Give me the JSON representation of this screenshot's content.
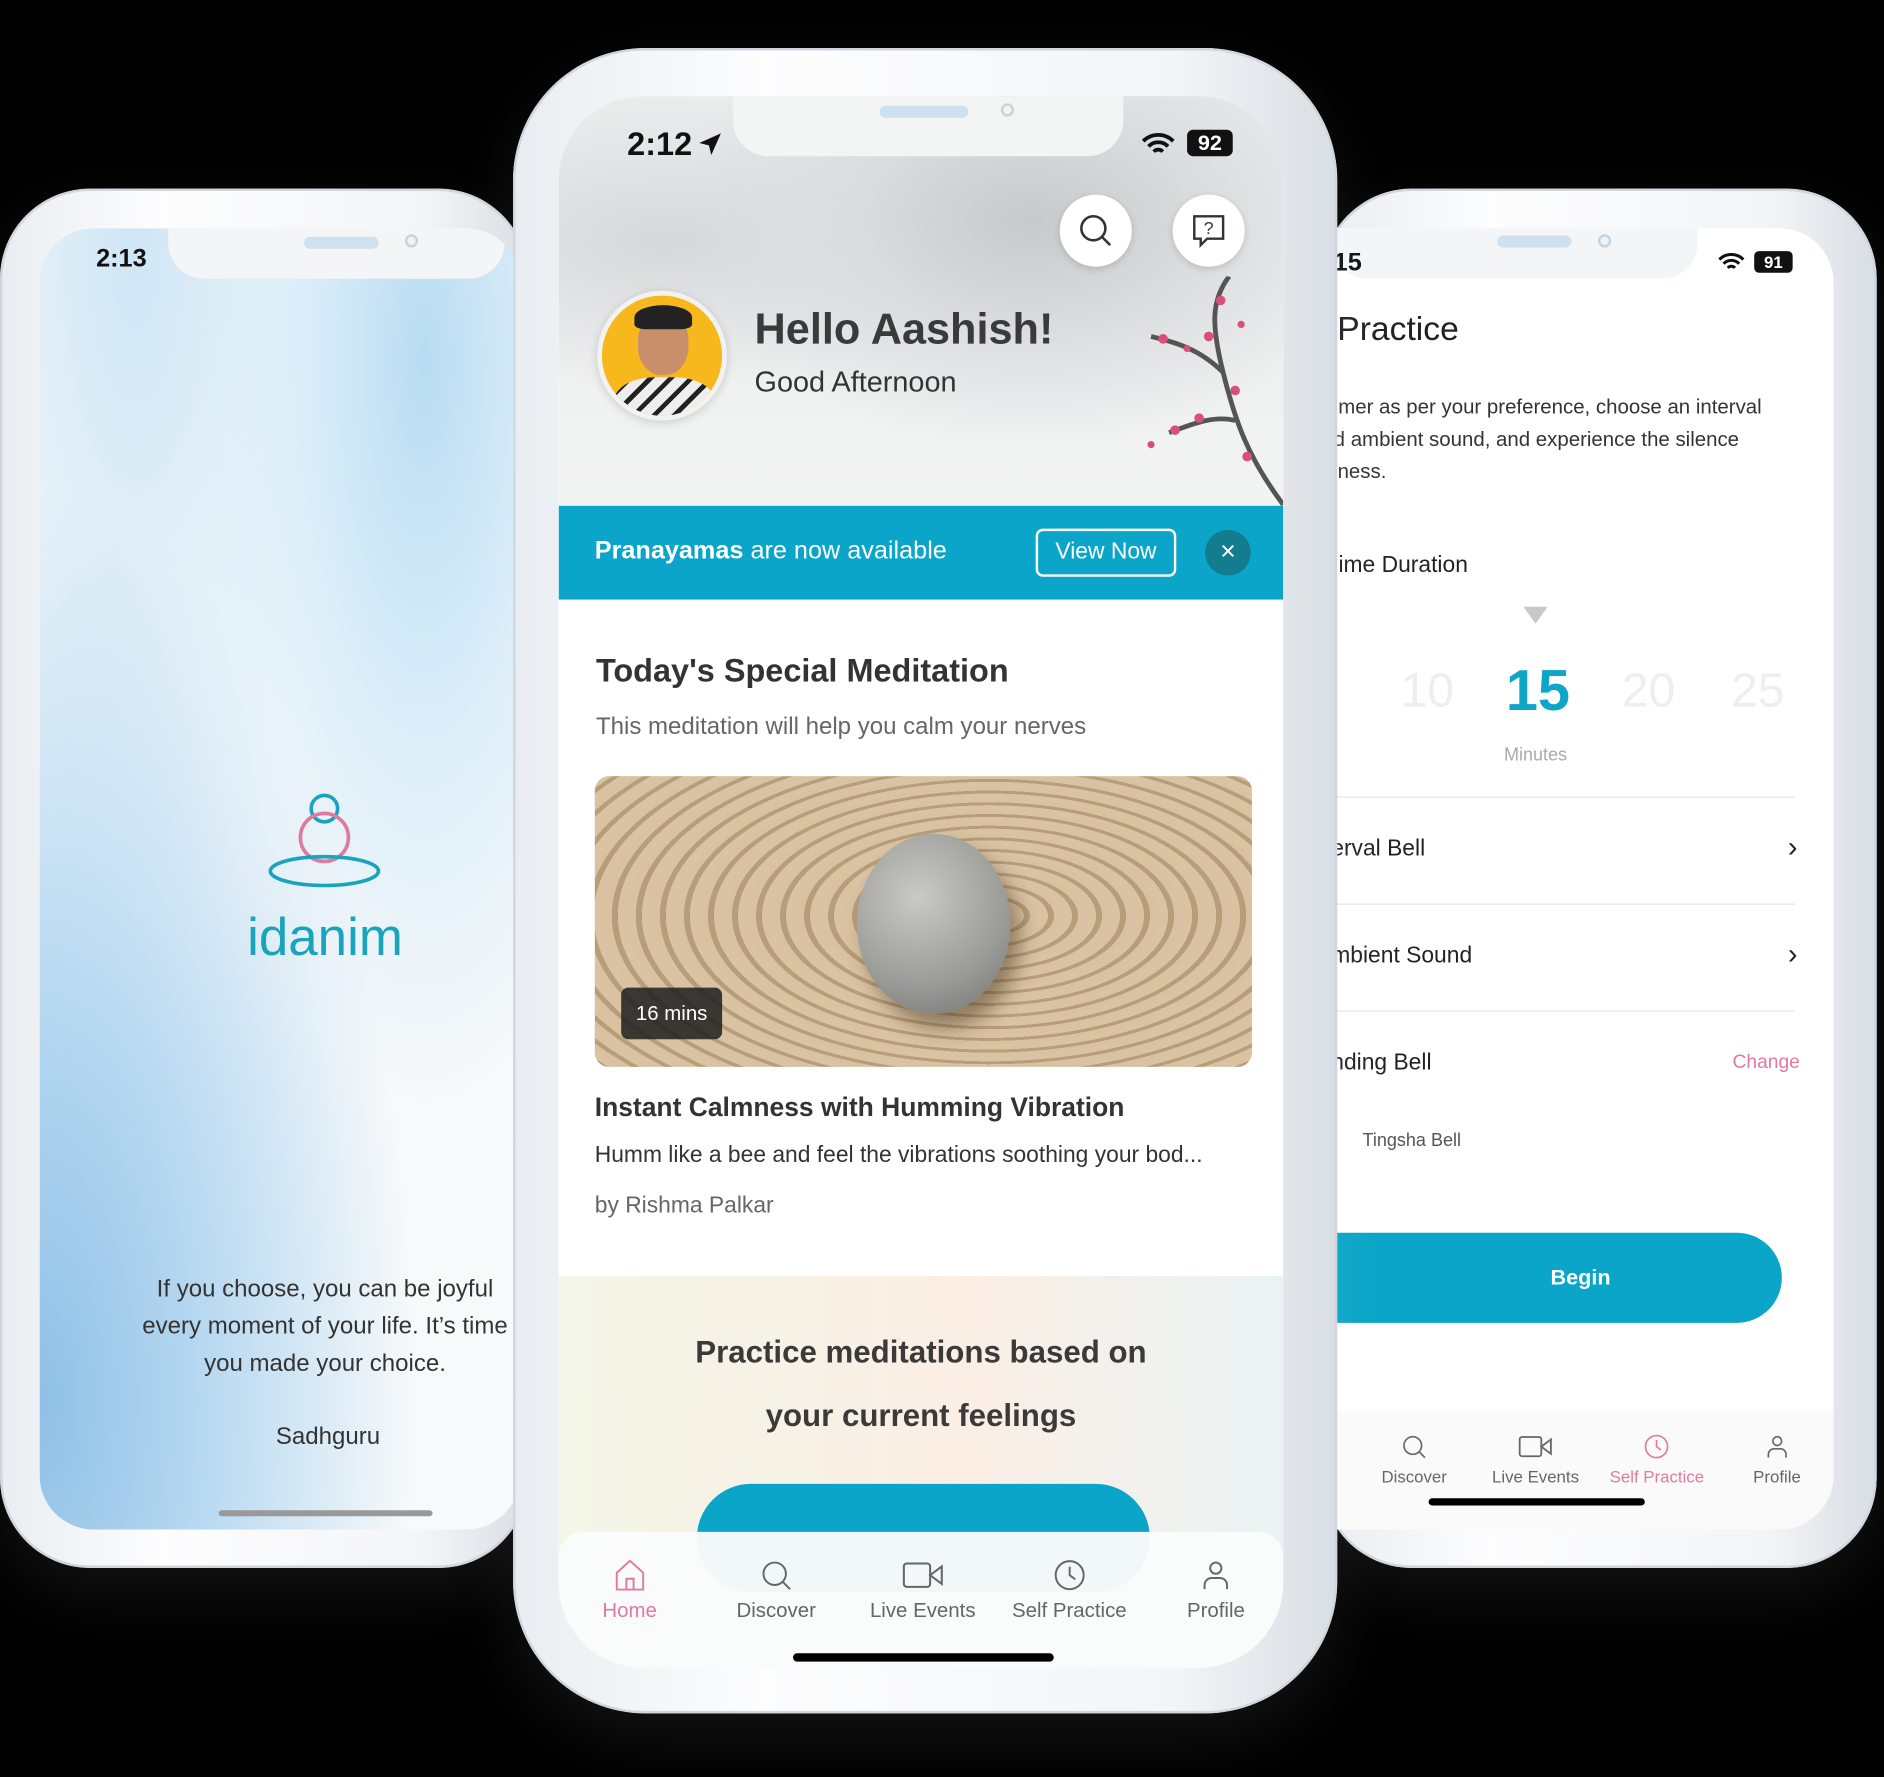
{
  "colors": {
    "accent": "#0ea5c6",
    "pink": "#e07aa0",
    "background": "#000000"
  },
  "left_phone": {
    "status_time": "2:13",
    "logo_text": "idanim",
    "quote_lines": [
      "If you choose, you can be joyful",
      "every moment of your life. It’s time",
      "you made your choice."
    ],
    "quote_author": "Sadhguru"
  },
  "center_phone": {
    "status_time": "2:12",
    "battery": "92",
    "greeting": "Hello Aashish!",
    "subgreeting": "Good Afternoon",
    "icons": {
      "search": "search-icon",
      "help": "help-chat-icon"
    },
    "banner": {
      "bold": "Pranayamas",
      "text": " are now available",
      "button": "View Now",
      "close": "×"
    },
    "special": {
      "title": "Today's Special Meditation",
      "subtitle": "This meditation will help you calm your nerves",
      "duration": "16 mins",
      "card_title": "Instant Calmness with Humming Vibration",
      "card_desc": "Humm like a bee and feel the vibrations soothing your bod...",
      "author": "by Rishma Palkar"
    },
    "feelings": {
      "line1": "Practice meditations based on",
      "line2": "your current feelings"
    },
    "tabs": [
      {
        "label": "Home",
        "icon": "home-icon",
        "active": true
      },
      {
        "label": "Discover",
        "icon": "search-icon",
        "active": false
      },
      {
        "label": "Live Events",
        "icon": "video-camera-icon",
        "active": false
      },
      {
        "label": "Self Practice",
        "icon": "clock-icon",
        "active": false
      },
      {
        "label": "Profile",
        "icon": "user-icon",
        "active": false
      }
    ]
  },
  "right_phone": {
    "status_time": "15",
    "battery": "91",
    "title": "Practice",
    "desc_lines": [
      "imer as per your preference, choose an interval",
      "d ambient sound, and experience the silence",
      "'ness."
    ],
    "duration_label": "ime Duration",
    "picker": {
      "values": [
        "10",
        "15",
        "20",
        "25"
      ],
      "selected": "15",
      "unit": "Minutes"
    },
    "rows": [
      {
        "label": "erval Bell"
      },
      {
        "label": "mbient Sound"
      }
    ],
    "ending_bell": {
      "label": "nding Bell",
      "action": "Change",
      "value": "Tingsha Bell"
    },
    "begin": "Begin",
    "tabs": [
      {
        "label": "Discover",
        "icon": "search-icon",
        "active": false
      },
      {
        "label": "Live Events",
        "icon": "video-camera-icon",
        "active": false
      },
      {
        "label": "Self Practice",
        "icon": "clock-icon",
        "active": true
      },
      {
        "label": "Profile",
        "icon": "user-icon",
        "active": false
      }
    ]
  }
}
